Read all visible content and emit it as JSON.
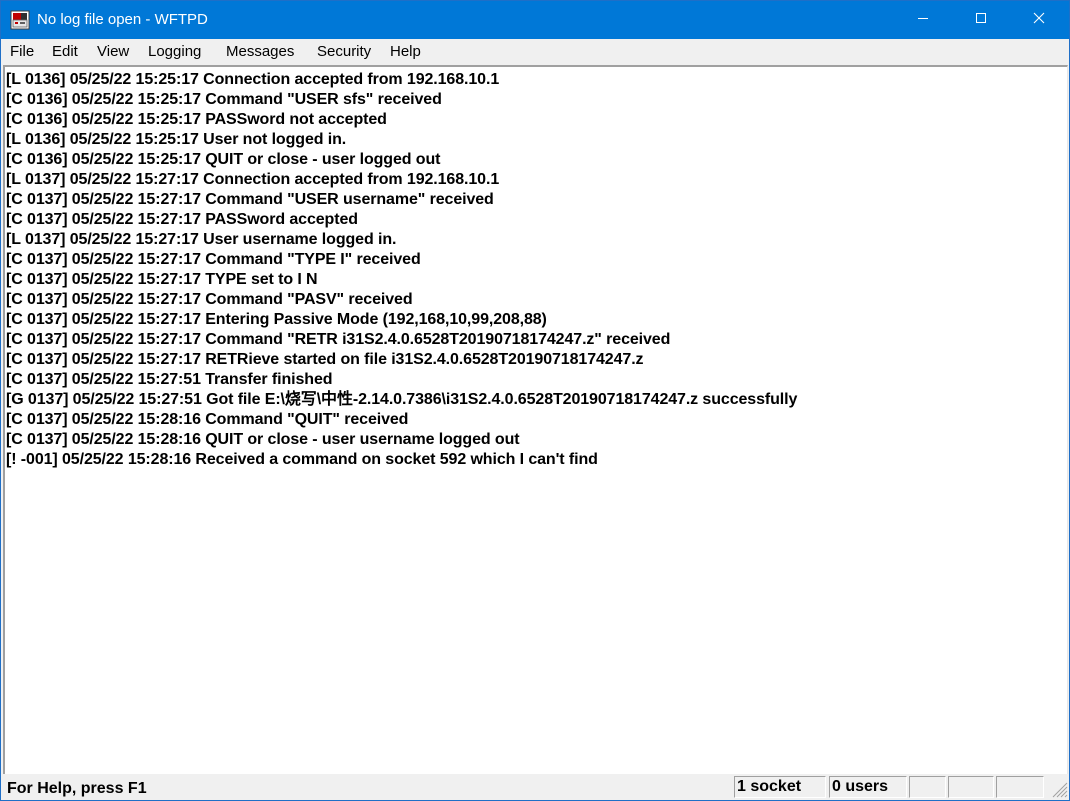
{
  "window": {
    "title": "No log file open - WFTPD",
    "app_icon": "wftpd-app-icon",
    "controls": {
      "minimize_icon": "minimize-icon",
      "maximize_icon": "maximize-icon",
      "close_icon": "close-icon"
    },
    "colors": {
      "titlebar": "#0078d7",
      "title_text": "#ffffff",
      "menubar": "#f0f0f0",
      "log_background": "#ffffff",
      "log_text": "#000000"
    }
  },
  "menu": {
    "items": [
      {
        "label": "File"
      },
      {
        "label": "Edit"
      },
      {
        "label": "View"
      },
      {
        "label": "Logging"
      },
      {
        "label": "Messages"
      },
      {
        "label": "Security"
      },
      {
        "label": "Help"
      }
    ]
  },
  "log": {
    "lines": [
      "[L 0136] 05/25/22 15:25:17 Connection accepted from 192.168.10.1",
      "[C 0136] 05/25/22 15:25:17 Command \"USER sfs\" received",
      "[C 0136] 05/25/22 15:25:17 PASSword not accepted",
      "[L 0136] 05/25/22 15:25:17 User not logged in.",
      "[C 0136] 05/25/22 15:25:17 QUIT or close - user  logged out",
      "[L 0137] 05/25/22 15:27:17 Connection accepted from 192.168.10.1",
      "[C 0137] 05/25/22 15:27:17 Command \"USER username\" received",
      "[C 0137] 05/25/22 15:27:17 PASSword accepted",
      "[L 0137] 05/25/22 15:27:17 User username logged in.",
      "[C 0137] 05/25/22 15:27:17 Command \"TYPE I\" received",
      "[C 0137] 05/25/22 15:27:17 TYPE set to I N",
      "[C 0137] 05/25/22 15:27:17 Command \"PASV\" received",
      "[C 0137] 05/25/22 15:27:17 Entering Passive Mode (192,168,10,99,208,88)",
      "[C 0137] 05/25/22 15:27:17 Command \"RETR i31S2.4.0.6528T20190718174247.z\" received",
      "[C 0137] 05/25/22 15:27:17 RETRieve started on file i31S2.4.0.6528T20190718174247.z",
      "[C 0137] 05/25/22 15:27:51 Transfer finished",
      "[G 0137] 05/25/22 15:27:51 Got file E:\\烧写\\中性-2.14.0.7386\\i31S2.4.0.6528T20190718174247.z successfully",
      "[C 0137] 05/25/22 15:28:16 Command \"QUIT\" received",
      "[C 0137] 05/25/22 15:28:16 QUIT or close - user username logged out",
      "[! -001] 05/25/22 15:28:16 Received a command on socket 592 which I can't find"
    ]
  },
  "status": {
    "help_text": "For Help, press F1",
    "sockets": "1 socket",
    "users": "0 users",
    "grip_icon": "size-grip-icon"
  }
}
